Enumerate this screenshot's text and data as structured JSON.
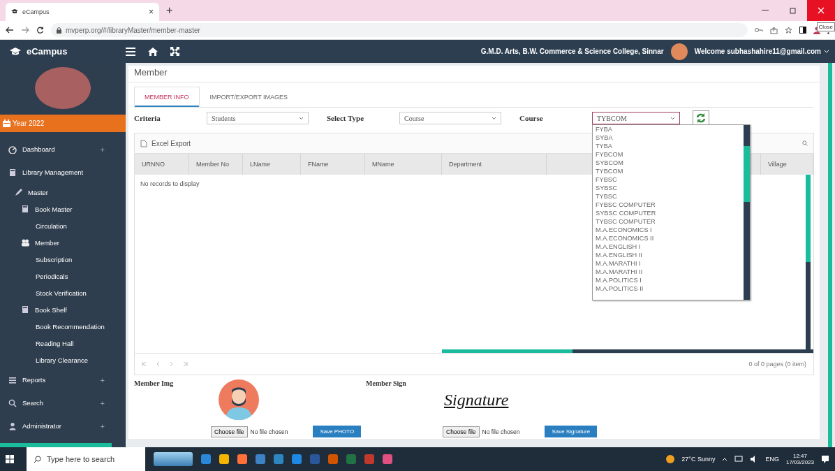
{
  "browser": {
    "tab_title": "eCampus",
    "tab_close": "×",
    "new_tab": "+",
    "url": "mvperp.org/#/libraryMaster/member-master",
    "tooltip": "Close"
  },
  "header": {
    "brand": "eCampus",
    "college": "G.M.D. Arts, B.W. Commerce & Science College, Sinnar",
    "welcome": "Welcome subhashahire11@gmail.com"
  },
  "sidebar": {
    "year": "Year 2022",
    "items": [
      {
        "label": "Dashboard",
        "kind": "dashboard",
        "expander": "+"
      },
      {
        "label": "Library Management",
        "kind": "library",
        "children": [
          {
            "label": "Master",
            "kind": "master",
            "children": [
              {
                "label": "Book Master",
                "kind": "book",
                "children": [
                  {
                    "label": "Circulation"
                  }
                ]
              },
              {
                "label": "Member",
                "kind": "member",
                "children": [
                  {
                    "label": "Subscription"
                  },
                  {
                    "label": "Periodicals"
                  },
                  {
                    "label": "Stock Verification"
                  }
                ]
              },
              {
                "label": "Book Shelf",
                "kind": "book",
                "children": [
                  {
                    "label": "Book Recommendation"
                  },
                  {
                    "label": "Reading Hall"
                  },
                  {
                    "label": "Library Clearance"
                  }
                ]
              }
            ]
          }
        ]
      },
      {
        "label": "Reports",
        "kind": "reports",
        "expander": "+"
      },
      {
        "label": "Search",
        "kind": "search",
        "expander": "+"
      },
      {
        "label": "Administrator",
        "kind": "admin",
        "expander": "+"
      }
    ]
  },
  "page_title": "Member",
  "tabs": [
    {
      "label": "MEMBER INFO",
      "selected": true
    },
    {
      "label": "IMPORT/EXPORT IMAGES",
      "selected": false
    }
  ],
  "filters": [
    {
      "label": "Criteria",
      "value": "Students",
      "open": false
    },
    {
      "label": "Select Type",
      "value": "Course",
      "open": false
    },
    {
      "label": "Course",
      "value": "TYBCOM",
      "open": true
    }
  ],
  "course_options": [
    "FYBA",
    "SYBA",
    "TYBA",
    "FYBCOM",
    "SYBCOM",
    "TYBCOM",
    "FYBSC",
    "SYBSC",
    "TYBSC",
    "FYBSC COMPUTER",
    "SYBSC COMPUTER",
    "TYBSC COMPUTER",
    "M.A.ECONOMICS I",
    "M.A.ECONOMICS II",
    "M.A.ENGLISH I",
    "M.A.ENGLISH II",
    "M.A.MARATHI I",
    "M.A.MARATHI II",
    "M.A.POLITICS I",
    "M.A.POLITICS II"
  ],
  "grid": {
    "export": "Excel Export",
    "columns": [
      "URNNO",
      "Member No",
      "LName",
      "FName",
      "MName",
      "Department",
      "",
      "Village"
    ],
    "empty": "No records to display",
    "pager": "0 of 0 pages (0 item)"
  },
  "images": [
    {
      "label": "Member Img",
      "kind": "photo",
      "file_button": "Choose file",
      "file_status": "No file chosen",
      "save": "Save PHOTO"
    },
    {
      "label": "Member Sign",
      "kind": "signature",
      "signature": "Signature",
      "file_button": "Choose file",
      "file_status": "No file chosen",
      "save": "Save Signature"
    }
  ],
  "taskbar": {
    "search": "Type here to search",
    "weather": "27°C Sunny",
    "lang": "ENG",
    "time": "12:47",
    "date": "17/03/2023"
  }
}
